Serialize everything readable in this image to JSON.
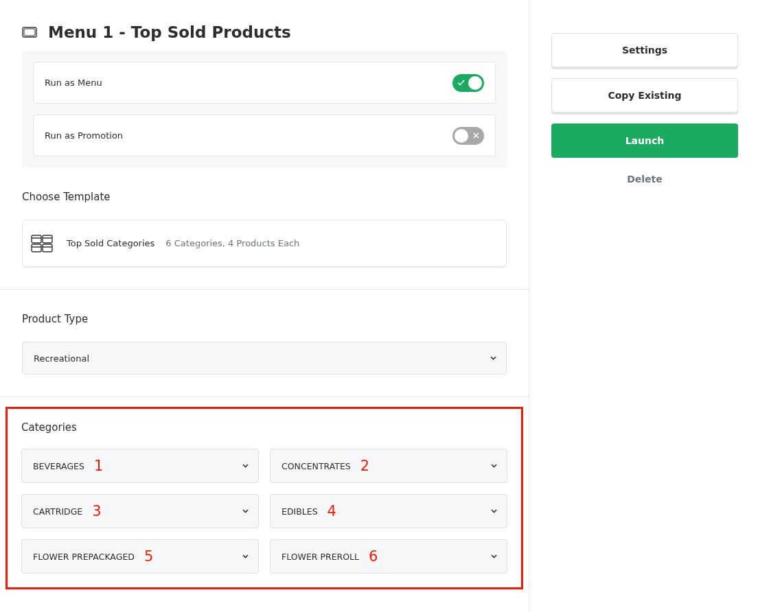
{
  "title": "Menu 1 - Top Sold Products",
  "run_options": [
    {
      "label": "Run as Menu",
      "on": true
    },
    {
      "label": "Run as Promotion",
      "on": false
    }
  ],
  "template": {
    "heading": "Choose Template",
    "name": "Top Sold Categories",
    "description": "6 Categories, 4 Products Each"
  },
  "product_type": {
    "heading": "Product Type",
    "value": "Recreational"
  },
  "categories": {
    "heading": "Categories",
    "highlighted": true,
    "items": [
      {
        "value": "BEVERAGES",
        "marker": "1"
      },
      {
        "value": "CONCENTRATES",
        "marker": "2"
      },
      {
        "value": "CARTRIDGE",
        "marker": "3"
      },
      {
        "value": "EDIBLES",
        "marker": "4"
      },
      {
        "value": "FLOWER PREPACKAGED",
        "marker": "5"
      },
      {
        "value": "FLOWER PREROLL",
        "marker": "6"
      }
    ]
  },
  "actions": [
    {
      "label": "Settings",
      "kind": "outline"
    },
    {
      "label": "Copy Existing",
      "kind": "outline"
    },
    {
      "label": "Launch",
      "kind": "primary"
    },
    {
      "label": "Delete",
      "kind": "link"
    }
  ]
}
